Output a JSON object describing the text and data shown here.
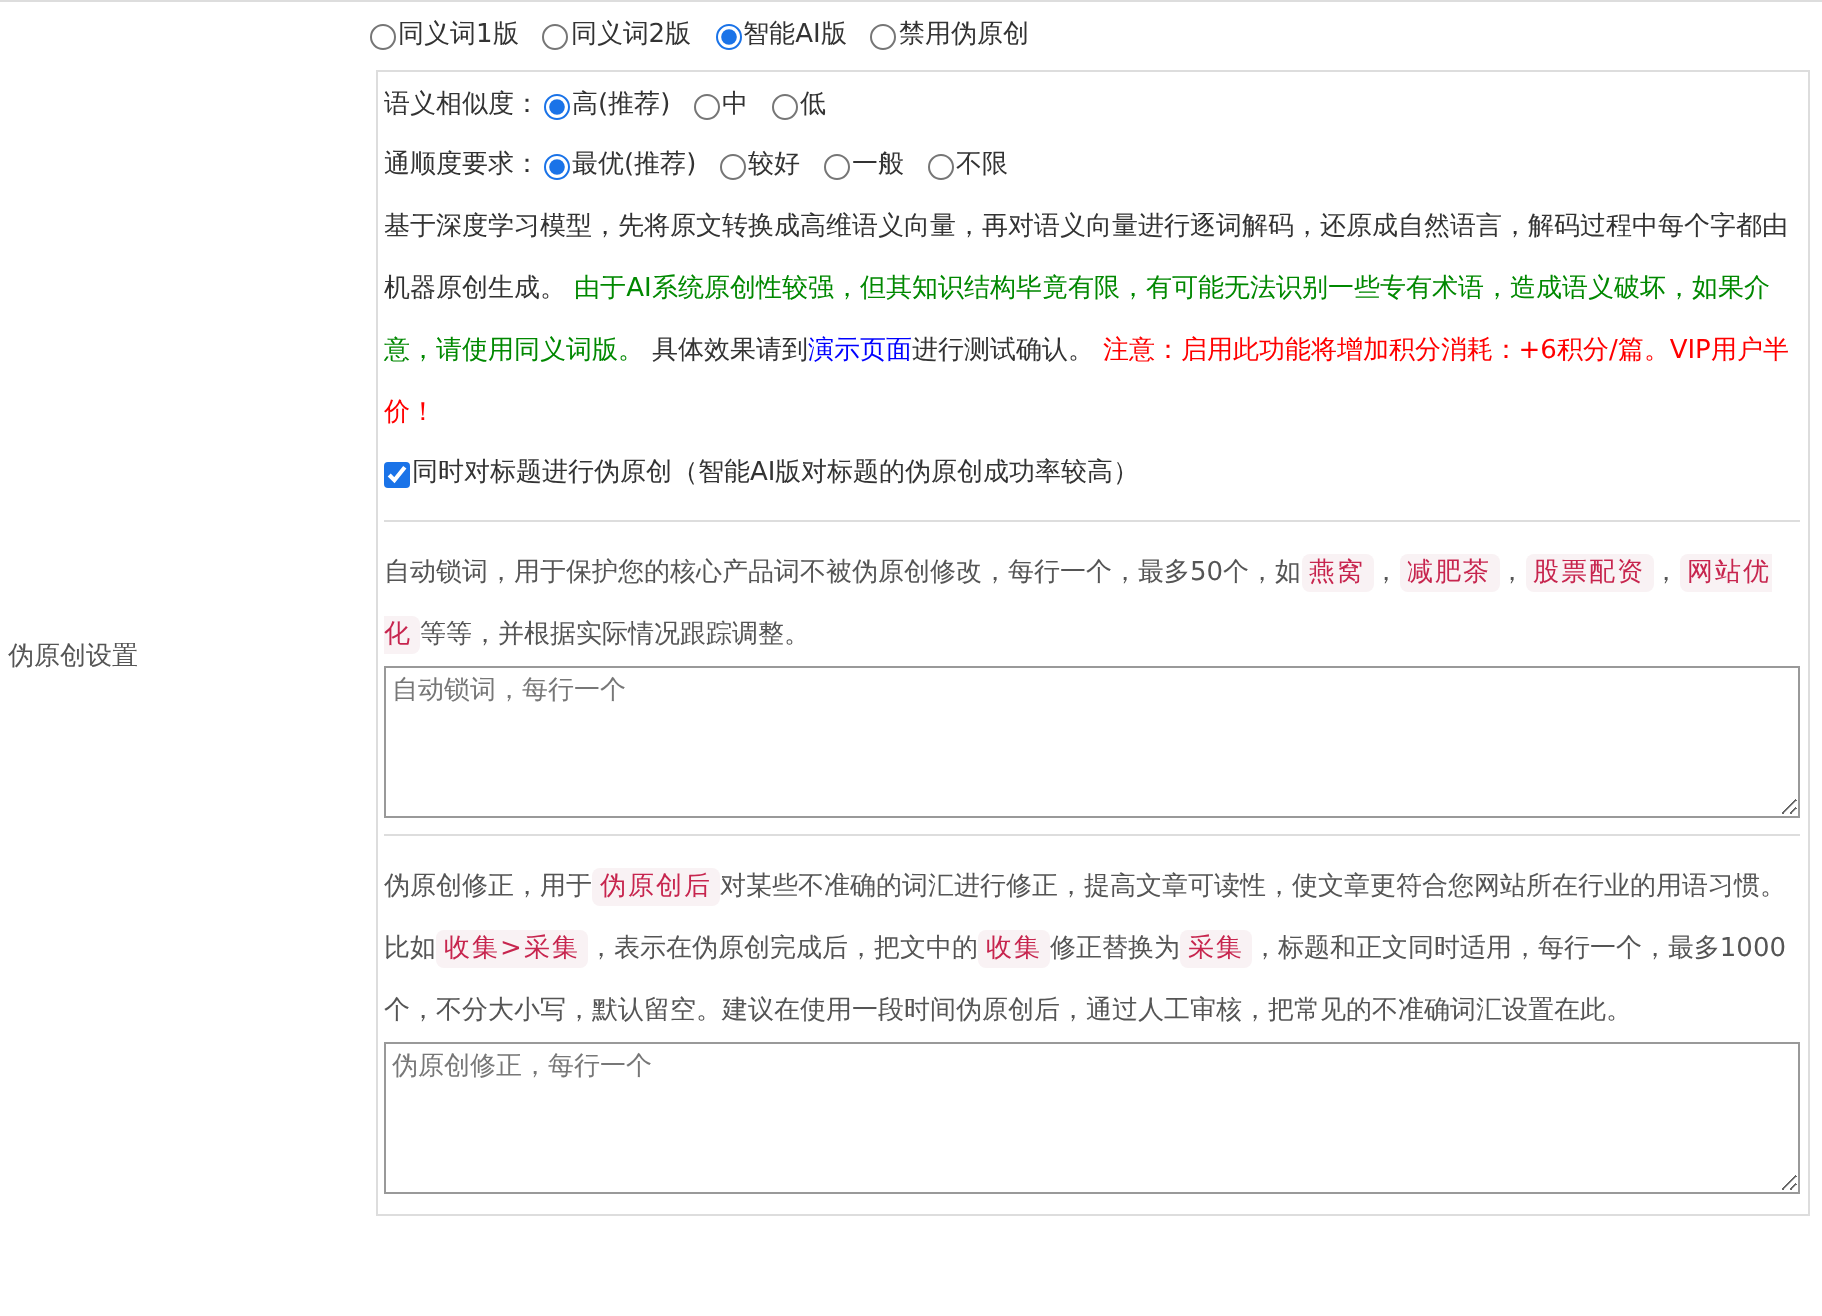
{
  "side_label": "伪原创设置",
  "modes": [
    {
      "label": "同义词1版",
      "selected": false
    },
    {
      "label": "同义词2版",
      "selected": false
    },
    {
      "label": "智能AI版",
      "selected": true
    },
    {
      "label": "禁用伪原创",
      "selected": false
    }
  ],
  "similarity": {
    "label": "语义相似度：",
    "options": [
      {
        "label": "高(推荐)",
        "selected": true
      },
      {
        "label": "中",
        "selected": false
      },
      {
        "label": "低",
        "selected": false
      }
    ]
  },
  "fluency": {
    "label": "通顺度要求：",
    "options": [
      {
        "label": "最优(推荐)",
        "selected": true
      },
      {
        "label": "较好",
        "selected": false
      },
      {
        "label": "一般",
        "selected": false
      },
      {
        "label": "不限",
        "selected": false
      }
    ]
  },
  "ai_description": [
    {
      "kind": "plain",
      "text": "基于深度学习模型，先将原文转换成高维语义向量，再对语义向量进行逐词解码，还原成自然语言，解码过程中每个字都由机器原创生成。 "
    },
    {
      "kind": "green",
      "text": "由于AI系统原创性较强，但其知识结构毕竟有限，有可能无法识别一些专有术语，造成语义破坏，如果介意，请使用同义词版。"
    },
    {
      "kind": "plain",
      "text": " 具体效果请到"
    },
    {
      "kind": "link",
      "text": "演示页面"
    },
    {
      "kind": "plain",
      "text": "进行测试确认。 "
    },
    {
      "kind": "red",
      "text": "注意：启用此功能将增加积分消耗：+6积分/篇。VIP用户半价！"
    }
  ],
  "title_option": {
    "label": "同时对标题进行伪原创（智能AI版对标题的伪原创成功率较高）",
    "checked": true
  },
  "lock_words": {
    "description": [
      {
        "kind": "plain",
        "text": "自动锁词，用于保护您的核心产品词不被伪原创修改，每行一个，最多50个，如"
      },
      {
        "kind": "code",
        "text": "燕窝"
      },
      {
        "kind": "plain",
        "text": "，"
      },
      {
        "kind": "code",
        "text": "减肥茶"
      },
      {
        "kind": "plain",
        "text": "，"
      },
      {
        "kind": "code",
        "text": "股票配资"
      },
      {
        "kind": "plain",
        "text": "，"
      },
      {
        "kind": "code",
        "text": "网站优化"
      },
      {
        "kind": "plain",
        "text": "等等，并根据实际情况跟踪调整。"
      }
    ],
    "placeholder": "自动锁词，每行一个"
  },
  "corrections": {
    "description": [
      {
        "kind": "plain",
        "text": "伪原创修正，用于"
      },
      {
        "kind": "code",
        "text": "伪原创后"
      },
      {
        "kind": "plain",
        "text": "对某些不准确的词汇进行修正，提高文章可读性，使文章更符合您网站所在行业的用语习惯。比如"
      },
      {
        "kind": "code",
        "text": "收集>采集"
      },
      {
        "kind": "plain",
        "text": "，表示在伪原创完成后，把文中的"
      },
      {
        "kind": "code",
        "text": "收集"
      },
      {
        "kind": "plain",
        "text": "修正替换为"
      },
      {
        "kind": "code",
        "text": "采集"
      },
      {
        "kind": "plain",
        "text": "，标题和正文同时适用，每行一个，最多1000个，不分大小写，默认留空。建议在使用一段时间伪原创后，通过人工审核，把常见的不准确词汇设置在此。"
      }
    ],
    "placeholder": "伪原创修正，每行一个"
  }
}
